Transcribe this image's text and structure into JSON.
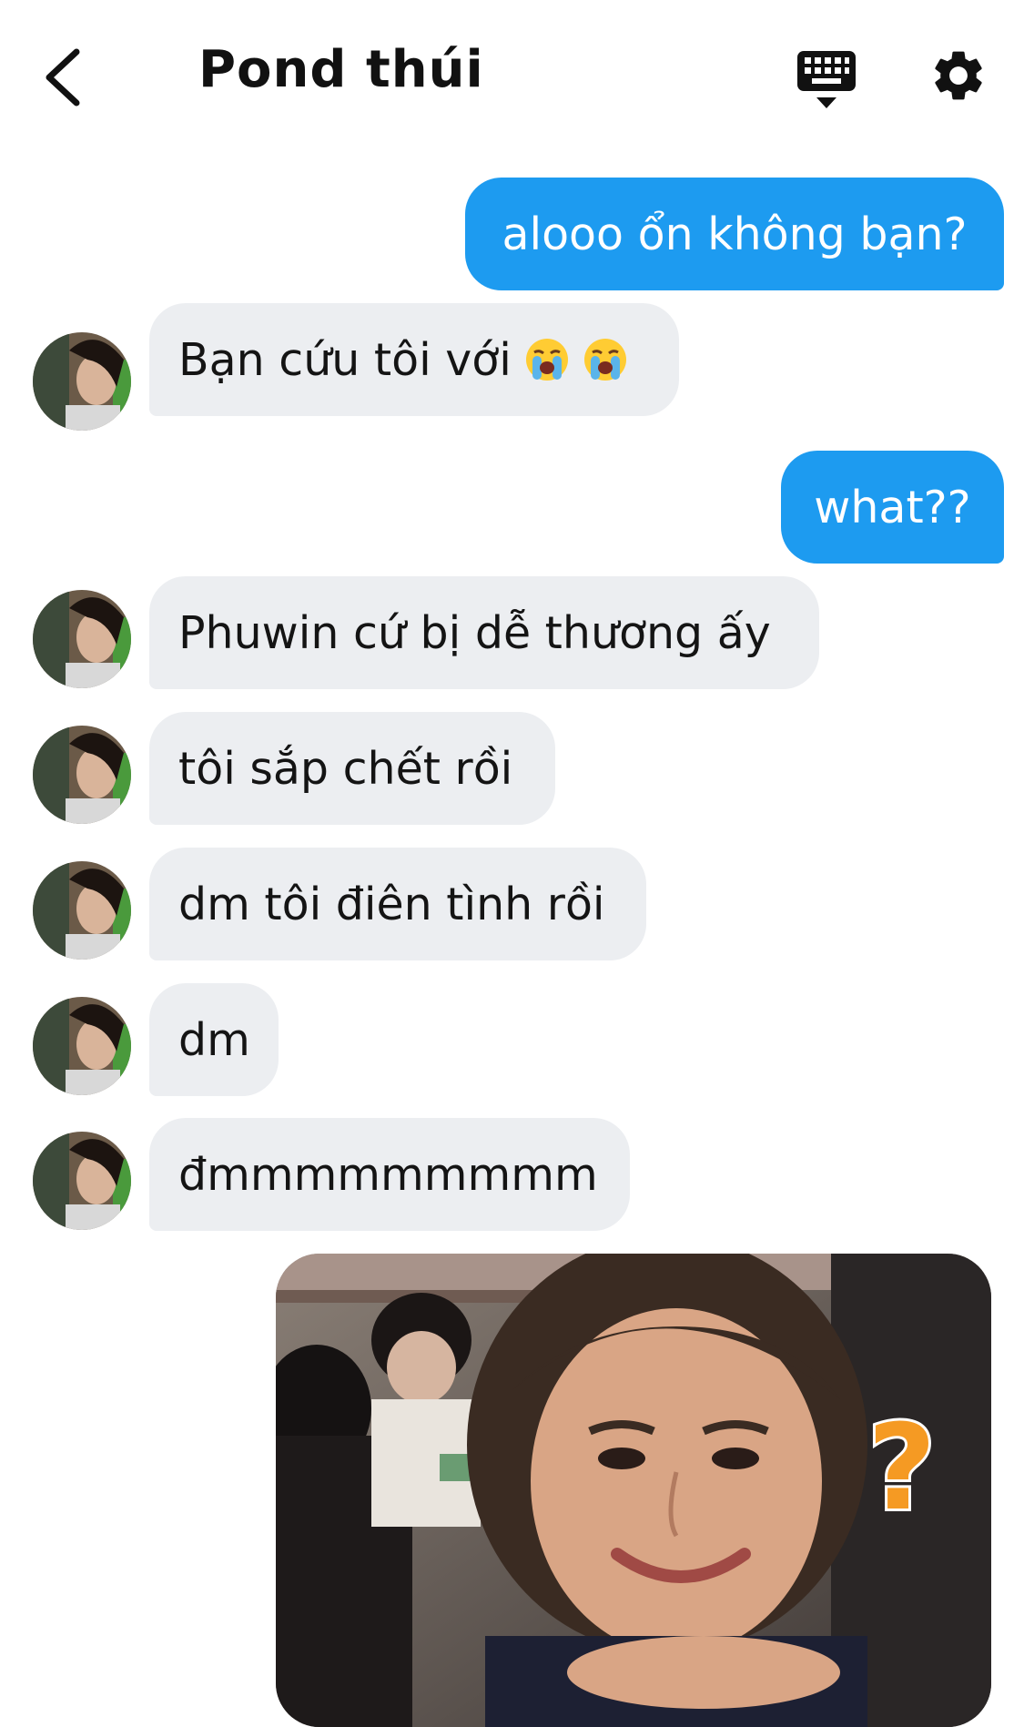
{
  "header": {
    "title": "Pond thúi",
    "back_icon": "chevron-left-icon",
    "keyboard_icon": "keyboard-icon",
    "settings_icon": "gear-icon"
  },
  "messages": [
    {
      "direction": "outgoing",
      "text": "alooo ổn không bạn?"
    },
    {
      "direction": "incoming",
      "text": "Bạn cứu tôi với",
      "emoji": [
        "loudly-crying-face-emoji",
        "loudly-crying-face-emoji"
      ]
    },
    {
      "direction": "outgoing",
      "text": "what??"
    },
    {
      "direction": "incoming",
      "text": "Phuwin cứ bị dễ thương ấy"
    },
    {
      "direction": "incoming",
      "text": "tôi sắp chết rồi"
    },
    {
      "direction": "incoming",
      "text": "dm tôi điên tình rồi"
    },
    {
      "direction": "incoming",
      "text": "dm"
    },
    {
      "direction": "incoming",
      "text": "đmmmmmmmmm"
    },
    {
      "direction": "outgoing",
      "type": "image",
      "image": "photo-of-smiling-person-with-question-mark-sticker"
    }
  ],
  "colors": {
    "outgoing_bubble": "#1d9bf0",
    "incoming_bubble": "#eceef1",
    "question_mark": "#f59a23"
  }
}
